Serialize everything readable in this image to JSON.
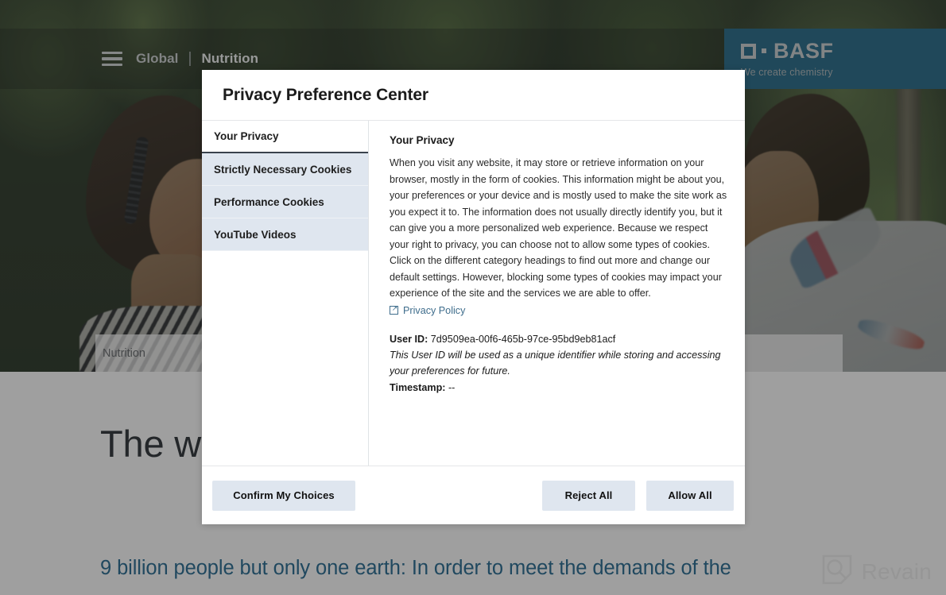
{
  "site": {
    "nav": {
      "menu_icon": "hamburger-menu-icon",
      "global_label": "Global",
      "separator": "|",
      "section_label": "Nutrition",
      "search_icon": "search-icon",
      "globe_icon": "globe-icon",
      "accessibility_icon": "accessibility-icon"
    },
    "logo": {
      "wordmark": "BASF",
      "tagline": "We create chemistry",
      "mark_icon": "basf-square-icon",
      "dot_icon": "basf-dot-icon",
      "brand_color": "#186282"
    },
    "breadcrumb": "Nutrition",
    "headline": "The world is out of balance.",
    "subhead": "9 billion people but only one earth: In order to meet the demands of the",
    "watermark": {
      "label": "Revain",
      "icon": "revain-logo-icon"
    }
  },
  "modal": {
    "title": "Privacy Preference Center",
    "tabs": [
      {
        "label": "Your Privacy",
        "active": true
      },
      {
        "label": "Strictly Necessary Cookies",
        "active": false
      },
      {
        "label": "Performance Cookies",
        "active": false
      },
      {
        "label": "YouTube Videos",
        "active": false
      }
    ],
    "content": {
      "heading": "Your Privacy",
      "paragraph": "When you visit any website, it may store or retrieve information on your browser, mostly in the form of cookies. This information might be about you, your preferences or your device and is mostly used to make the site work as you expect it to. The information does not usually directly identify you, but it can give you a more personalized web experience. Because we respect your right to privacy, you can choose not to allow some types of cookies. Click on the different category headings to find out more and change our default settings. However, blocking some types of cookies may impact your experience of the site and the services we are able to offer.",
      "privacy_policy_link": "Privacy Policy",
      "user_id_label": "User ID:",
      "user_id_value": "7d9509ea-00f6-465b-97ce-95bd9eb81acf",
      "user_id_note": "This User ID will be used as a unique identifier while storing and accessing your preferences for future.",
      "timestamp_label": "Timestamp:",
      "timestamp_value": "--"
    },
    "footer": {
      "confirm_label": "Confirm My Choices",
      "reject_label": "Reject All",
      "allow_label": "Allow All"
    }
  }
}
